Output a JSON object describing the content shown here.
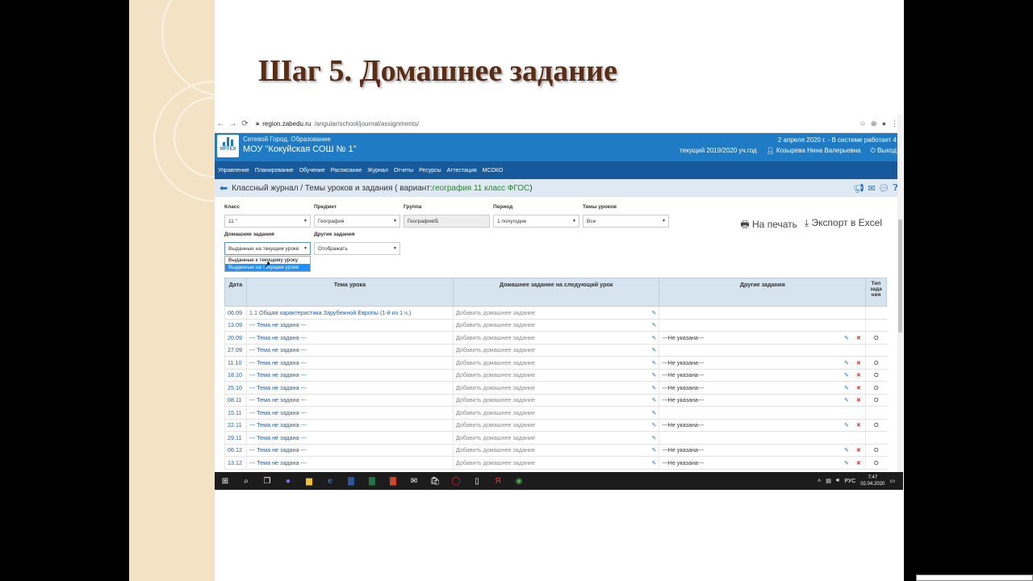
{
  "slide": {
    "title": "Шаг 5. Домашнее задание"
  },
  "browser": {
    "url_host": "region.zabedu.ru",
    "url_path": "/angular/school/journal/assignments/"
  },
  "header": {
    "logo_text": "ИРТЕХ",
    "org_sub": "Сетевой Город. Образование",
    "org_name": "МОУ \"Кокуйская СОШ № 1\"",
    "date_line": "2 апреля 2020 г. - В системе работает 4",
    "year": "текущий 2019/2020 уч.год",
    "user": "Козырева Нина Валерьевна",
    "logout": "Выход"
  },
  "menu": [
    "Управление",
    "Планирование",
    "Обучение",
    "Расписание",
    "Журнал",
    "Отчеты",
    "Ресурсы",
    "Аттестация",
    "МСОКО"
  ],
  "breadcrumb": {
    "text": "Классный журнал / Темы уроков и задания ( вариант: ",
    "variant": "география 11 класс ФГОС",
    "tail": ")"
  },
  "filters": {
    "class_label": "Класс",
    "class_value": "11 \"",
    "subject_label": "Предмет",
    "subject_value": "География",
    "group_label": "Группа",
    "group_value": "География/Б",
    "period_label": "Период",
    "period_value": "1 полугодие",
    "topics_label": "Темы уроков",
    "topics_value": "Все",
    "hw_label": "Домашние задания",
    "hw_value": "Выданные на текущем уроке",
    "other_label": "Другие задания",
    "other_value": "Отображать",
    "hw_options": [
      "Выданные к текущему уроку",
      "Выданные на текущем уроке"
    ]
  },
  "actions": {
    "print": "На печать",
    "export": "Экспорт в Excel"
  },
  "table": {
    "headers": {
      "date": "Дата",
      "topic": "Тема урока",
      "hw": "Домашнее задание на следующий урок",
      "other": "Другие задания",
      "type": "Тип зада ния"
    },
    "add_hw": "Добавить домашнее задание",
    "rows": [
      {
        "date": "06.09",
        "topic": "1.1 Общая характеристика Зарубежной Европы (1-й из 1 ч.)",
        "other": "",
        "type": ""
      },
      {
        "date": "13.09",
        "topic": "--- Тема не задана ---",
        "other": "",
        "type": ""
      },
      {
        "date": "20.09",
        "topic": "--- Тема не задана ---",
        "other": "---Не указана---",
        "type": "О"
      },
      {
        "date": "27.09",
        "topic": "--- Тема не задана ---",
        "other": "",
        "type": ""
      },
      {
        "date": "11.10",
        "topic": "--- Тема не задана ---",
        "other": "---Не указана---",
        "type": "О"
      },
      {
        "date": "18.10",
        "topic": "--- Тема не задана ---",
        "other": "---Не указана---",
        "type": "О"
      },
      {
        "date": "25.10",
        "topic": "--- Тема не задана ---",
        "other": "---Не указана---",
        "type": "О"
      },
      {
        "date": "08.11",
        "topic": "--- Тема не задана ---",
        "other": "---Не указана---",
        "type": "О"
      },
      {
        "date": "15.11",
        "topic": "--- Тема не задана ---",
        "other": "",
        "type": ""
      },
      {
        "date": "22.11",
        "topic": "--- Тема не задана ---",
        "other": "---Не указана---",
        "type": "О"
      },
      {
        "date": "29.11",
        "topic": "--- Тема не задана ---",
        "other": "",
        "type": ""
      },
      {
        "date": "06.12",
        "topic": "--- Тема не задана ---",
        "other": "---Не указана---",
        "type": "О"
      },
      {
        "date": "13.12",
        "topic": "--- Тема не задана ---",
        "other": "---Не указана---",
        "type": "О"
      }
    ]
  },
  "taskbar": {
    "lang": "РУС",
    "time": "7:47",
    "date": "02.04.2020"
  },
  "colors": {
    "header_blue": "#1f7cc4",
    "menu_blue": "#175a9b",
    "title_brown": "#5a2d17"
  }
}
